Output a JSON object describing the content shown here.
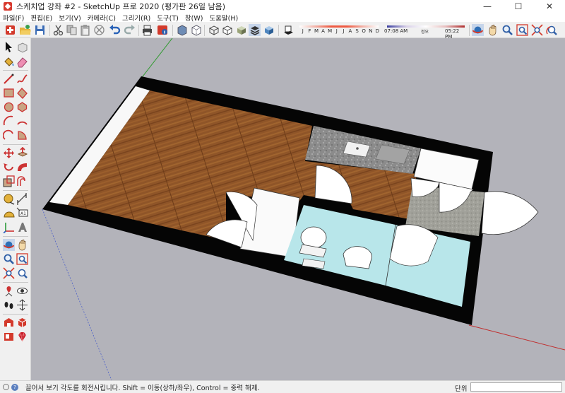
{
  "window": {
    "title": "스케치업 강좌 #2 - SketchUp 프로 2020 (평가판 26일 남음)",
    "minimize": "—",
    "maximize": "☐",
    "close": "✕"
  },
  "menu": [
    "파일(F)",
    "편집(E)",
    "보기(V)",
    "카메라(C)",
    "그리기(R)",
    "도구(T)",
    "창(W)",
    "도움말(H)"
  ],
  "shadow": {
    "months": [
      "J",
      "F",
      "M",
      "A",
      "M",
      "J",
      "J",
      "A",
      "S",
      "O",
      "N",
      "D"
    ],
    "time_start": "07:08 AM",
    "time_mid": "정오",
    "time_end": "05:22 PM"
  },
  "status": {
    "hint": "끌어서 보기 각도를 회전시킵니다. Shift = 이동(상하/좌우), Control = 중력 해제.",
    "measure_label": "단위",
    "measure_value": ""
  },
  "colors": {
    "viewport_bg": "#b3b3ba",
    "wood": "#8f5528",
    "wall": "#050505",
    "bathroom_tile": "#b8e6ea",
    "counter": "#8d8d8d",
    "stone_floor": "#a1a19a"
  },
  "icons": {
    "top_toolbar": [
      "new-model-icon",
      "open-icon",
      "save-icon",
      "cut-icon",
      "copy-icon",
      "paste-icon",
      "erase-icon",
      "undo-icon",
      "redo-icon",
      "print-icon",
      "model-info-icon",
      "xray-icon",
      "back-edges-icon",
      "wireframe-icon",
      "hidden-line-icon",
      "shaded-icon",
      "shaded-textures-icon",
      "monochrome-icon",
      "shadows-icon",
      "orbit-icon",
      "pan-icon",
      "zoom-icon",
      "zoom-window-icon",
      "zoom-extents-icon",
      "previous-view-icon"
    ],
    "left_toolbar": [
      "select-icon",
      "make-component-icon",
      "paint-bucket-icon",
      "eraser-icon",
      "line-icon",
      "freehand-icon",
      "rectangle-icon",
      "rotated-rectangle-icon",
      "circle-icon",
      "polygon-icon",
      "arc-icon",
      "two-point-arc-icon",
      "three-point-arc-icon",
      "pie-icon",
      "move-icon",
      "push-pull-icon",
      "rotate-icon",
      "follow-me-icon",
      "scale-icon",
      "offset-icon",
      "tape-measure-icon",
      "dimension-icon",
      "protractor-icon",
      "text-icon",
      "axes-icon",
      "3d-text-icon",
      "orbit-icon",
      "pan-icon",
      "zoom-icon",
      "zoom-window-icon",
      "zoom-extents-icon",
      "previous-icon",
      "position-camera-icon",
      "look-around-icon",
      "walk-icon",
      "section-plane-icon",
      "warehouse-icon",
      "extension-warehouse-icon",
      "send-to-layout-icon",
      "ruby-icon"
    ]
  }
}
